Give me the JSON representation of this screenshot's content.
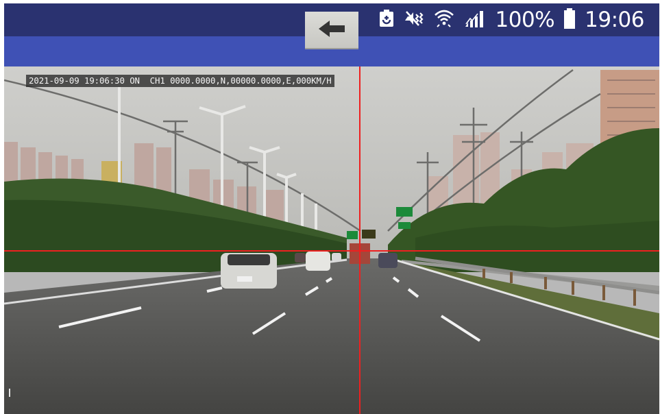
{
  "status_bar": {
    "battery_text": "100%",
    "time": "19:06",
    "icons": [
      "battery-saver-icon",
      "vibrate-mute-icon",
      "wifi-icon",
      "signal-bars-icon",
      "battery-icon"
    ]
  },
  "toolbar": {
    "back_icon": "back-arrow-icon"
  },
  "video": {
    "osd_text": "2021-09-09 19:06:30 ON  CH1 0000.0000,N,00000.0000,E,000KM/H",
    "overlays": [
      "vertical-center-guide",
      "horizon-guide"
    ],
    "guide_color": "#ee2020"
  },
  "colors": {
    "status_bar": "#2a3270",
    "app_bar": "#3f51b5"
  }
}
